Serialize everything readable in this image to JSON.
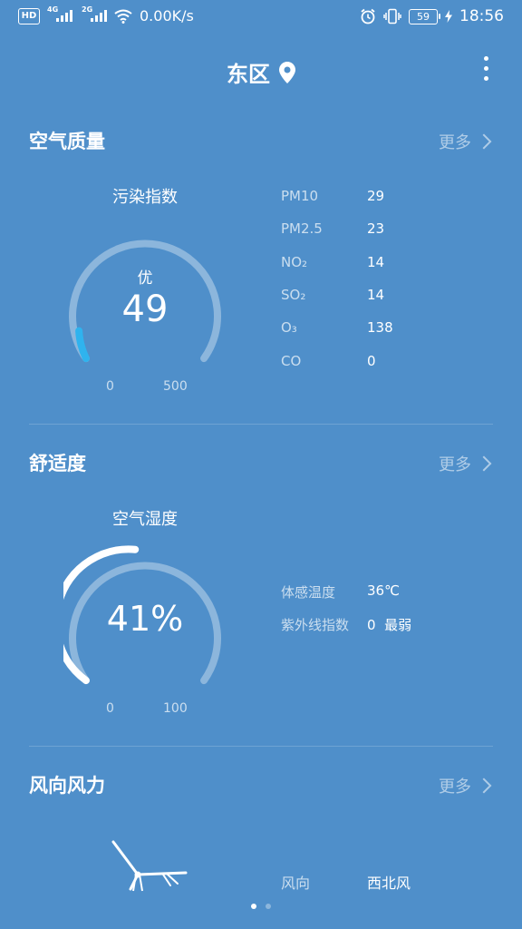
{
  "status_bar": {
    "hd": "HD",
    "sim1": "4G",
    "sim2": "2G",
    "speed": "0.00K/s",
    "battery": "59",
    "time": "18:56"
  },
  "header": {
    "location": "东区"
  },
  "air_quality": {
    "title": "空气质量",
    "more": "更多",
    "gauge_title": "污染指数",
    "level": "优",
    "value": "49",
    "min": "0",
    "max": "500",
    "pollutants": [
      {
        "name": "PM10",
        "value": "29"
      },
      {
        "name": "PM2.5",
        "value": "23"
      },
      {
        "name": "NO₂",
        "value": "14"
      },
      {
        "name": "SO₂",
        "value": "14"
      },
      {
        "name": "O₃",
        "value": "138"
      },
      {
        "name": "CO",
        "value": "0"
      }
    ]
  },
  "comfort": {
    "title": "舒适度",
    "more": "更多",
    "gauge_title": "空气湿度",
    "value": "41%",
    "min": "0",
    "max": "100",
    "details": [
      {
        "name": "体感温度",
        "value": "36℃"
      },
      {
        "name": "紫外线指数",
        "value": "0  最弱"
      }
    ]
  },
  "wind": {
    "title": "风向风力",
    "more": "更多",
    "direction_label": "风向",
    "direction_value": "西北风"
  }
}
